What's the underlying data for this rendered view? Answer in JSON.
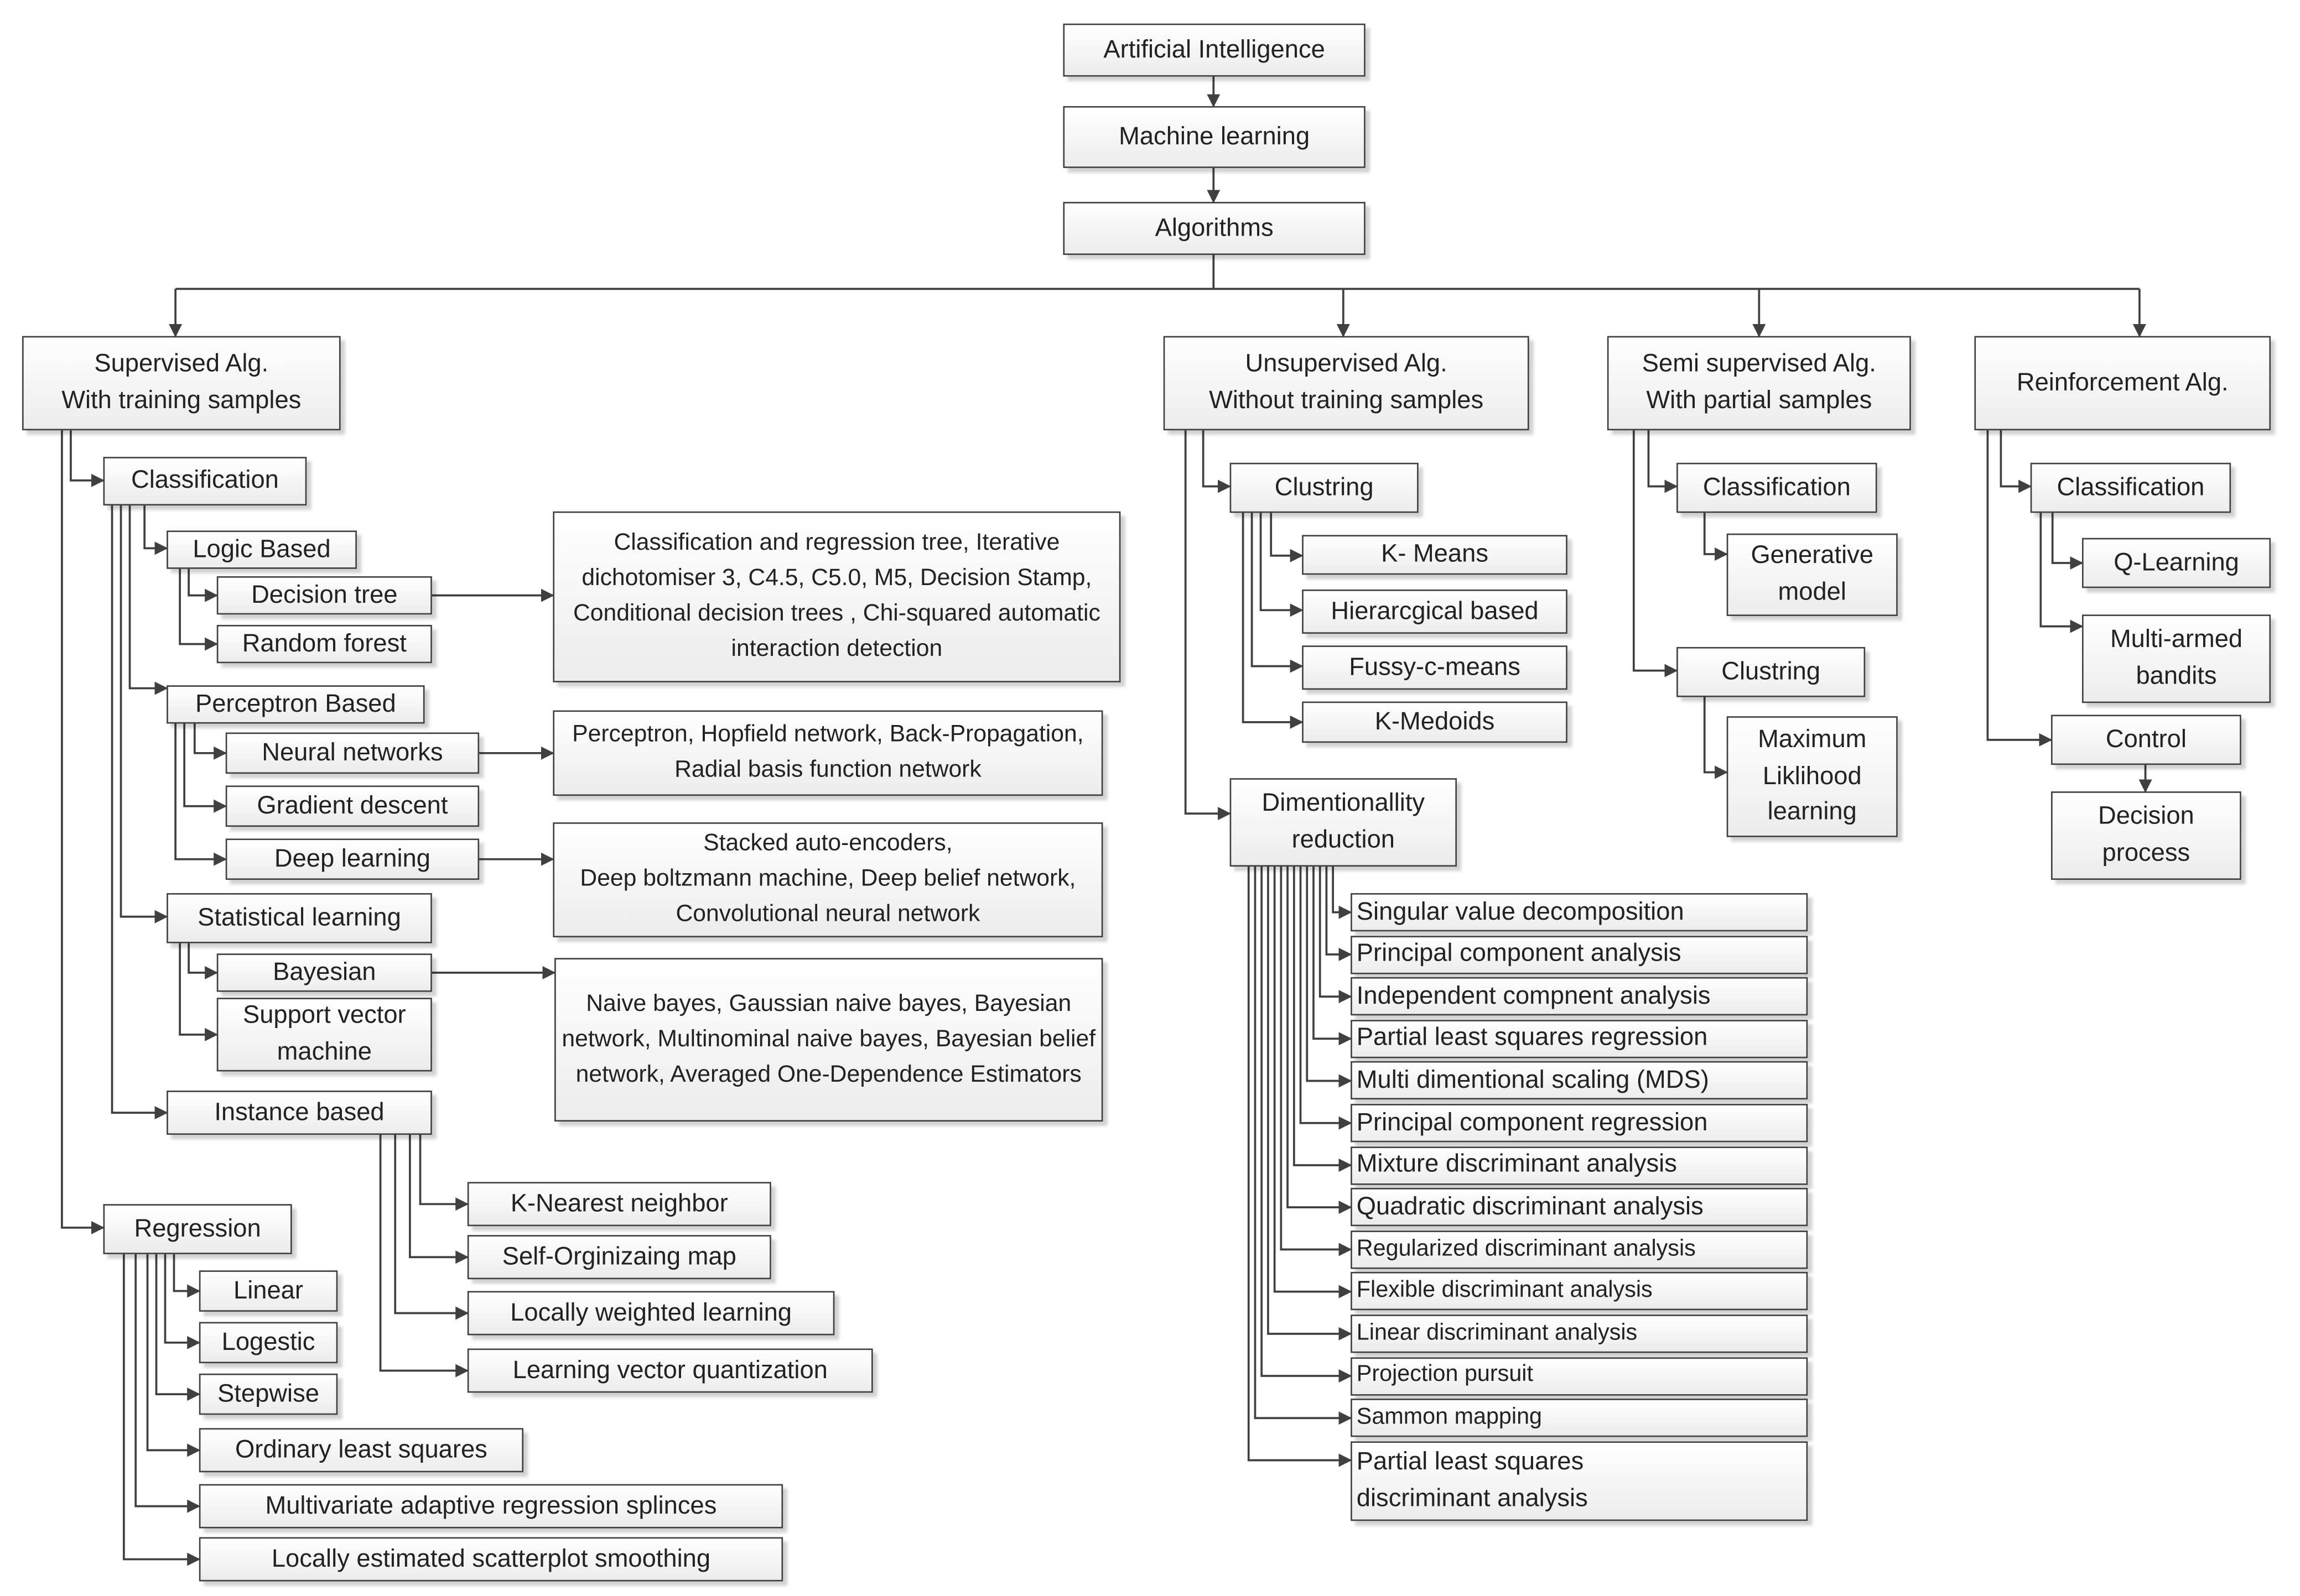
{
  "diagram": {
    "nodes": {
      "ai": "Artificial Intelligence",
      "ml": "Machine learning",
      "alg": "Algorithms",
      "sup": "Supervised Alg.\nWith training samples",
      "unsup": "Unsupervised Alg.\nWithout training samples",
      "semi": "Semi supervised Alg.\nWith partial samples",
      "reinf": "Reinforcement Alg.",
      "sup_cls": "Classification",
      "logic": "Logic Based",
      "dtree": "Decision tree",
      "rforest": "Random forest",
      "perc": "Perceptron Based",
      "nn": "Neural networks",
      "gd": "Gradient descent",
      "dl": "Deep learning",
      "stat": "Statistical learning",
      "bayes": "Bayesian",
      "svm": "Support vector\nmachine",
      "inst": "Instance based",
      "dtree_desc": "Classification and regression tree, Iterative dichotomiser 3, C4.5, C5.0, M5, Decision Stamp, Conditional decision trees , Chi-squared automatic interaction detection",
      "nn_desc": "Perceptron, Hopfield network, Back-Propagation, Radial basis function network",
      "dl_desc": "Stacked auto-encoders,\nDeep boltzmann machine, Deep belief network, Convolutional neural network",
      "bayes_desc": "Naive bayes, Gaussian naive bayes, Bayesian network, Multinominal naive bayes,  Bayesian belief network, Averaged One-Dependence Estimators",
      "knn": "K-Nearest neighbor",
      "som": "Self-Orginizaing map",
      "lwl": "Locally weighted learning",
      "lvq": "Learning vector quantization",
      "reg": "Regression",
      "linear": "Linear",
      "logestic": "Logestic",
      "stepwise": "Stepwise",
      "ols": "Ordinary least squares",
      "mars": "Multivariate adaptive regression splinces",
      "loess": "Locally estimated scatterplot smoothing",
      "un_clust": "Clustring",
      "kmeans": "K- Means",
      "hier": "Hierarcgical based",
      "fuzzy": "Fussy-c-means",
      "kmed": "K-Medoids",
      "dim": "Dimentionallity\nreduction",
      "svd": "Singular value decomposition",
      "pca": "Principal component analysis",
      "ica": "Independent compnent analysis",
      "plsr": "Partial least squares regression",
      "mds": "Multi dimentional scaling (MDS)",
      "pcr": "Principal component regression",
      "mda": "Mixture discriminant analysis",
      "qda": "Quadratic discriminant analysis",
      "rda": "Regularized discriminant analysis",
      "fda": "Flexible discriminant analysis",
      "lda": "Linear discriminant analysis",
      "pp": "Projection pursuit",
      "sm": "Sammon mapping",
      "plsda": "Partial least squares\ndiscriminant analysis",
      "semi_cls": "Classification",
      "gen": "Generative\nmodel",
      "semi_clust": "Clustring",
      "mll": "Maximum\nLiklihood\nlearning",
      "re_cls": "Classification",
      "ql": "Q-Learning",
      "mab": "Multi-armed\nbandits",
      "control": "Control",
      "dp": "Decision\nprocess"
    }
  }
}
